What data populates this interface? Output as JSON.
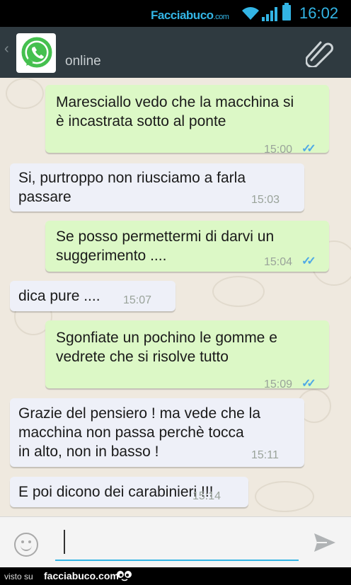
{
  "status_bar": {
    "brand_main": "Facciabuco",
    "brand_suffix": ".com",
    "time": "16:02"
  },
  "header": {
    "status": "online",
    "back_glyph": "‹"
  },
  "messages": [
    {
      "direction": "out",
      "text": "Maresciallo vedo che la macchina si\nè incastrata sotto al ponte",
      "time": "15:00",
      "ticks": "✓✓"
    },
    {
      "direction": "in",
      "text": "Si, purtroppo non riusciamo a farla\npassare",
      "time": "15:03"
    },
    {
      "direction": "out",
      "text": "Se posso permettermi di darvi un\nsuggerimento ....",
      "time": "15:04",
      "ticks": "✓✓"
    },
    {
      "direction": "in",
      "text": "dica pure ....",
      "time": "15:07"
    },
    {
      "direction": "out",
      "text": "Sgonfiate un pochino le gomme e\nvedrete che si risolve tutto",
      "time": "15:09",
      "ticks": "✓✓"
    },
    {
      "direction": "in",
      "text": "Grazie del pensiero ! ma vede che la\nmacchina non passa perchè tocca\nin alto, non in basso !",
      "time": "15:11"
    },
    {
      "direction": "in",
      "text": "E poi dicono dei carabinieri !!!",
      "time": "15:14"
    }
  ],
  "input": {
    "value": ""
  },
  "footer": {
    "visto_su": "visto su",
    "site": "facciabuco.com"
  },
  "colors": {
    "accent": "#33b5e5",
    "outgoing_bubble": "#dcf8c6",
    "incoming_bubble": "#eef0f8",
    "appbar": "#2f3a40",
    "chat_bg": "#efe9df"
  }
}
